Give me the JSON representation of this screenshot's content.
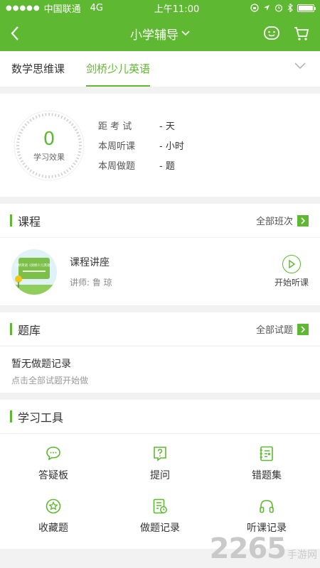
{
  "status": {
    "signal": "●●●●●",
    "carrier": "中国联通",
    "network": "4G",
    "time": "上午11:00",
    "battery_level": 1.0
  },
  "nav": {
    "title": "小学辅导"
  },
  "tabs": [
    {
      "label": "数学思维课",
      "active": false
    },
    {
      "label": "剑桥少儿英语",
      "active": true
    }
  ],
  "stats": {
    "score": "0",
    "score_label": "学习效果",
    "rows": [
      {
        "key": "距 考 试",
        "value": "- 天"
      },
      {
        "key": "本周听课",
        "value": "- 小时"
      },
      {
        "key": "本周做题",
        "value": "- 题"
      }
    ]
  },
  "course_section": {
    "title": "课程",
    "more": "全部班次",
    "item": {
      "name": "课程讲座",
      "teacher": "讲师:   鲁    琼",
      "action": "开始听课",
      "thumb_text": "剑桥英语《剑桥少儿英语》"
    }
  },
  "quiz_section": {
    "title": "题库",
    "more": "全部试题",
    "empty_title": "暂无做题记录",
    "empty_hint": "点击全部试题开始做"
  },
  "tools_section": {
    "title": "学习工具",
    "items": [
      {
        "label": "答疑板",
        "icon": "chat-icon"
      },
      {
        "label": "提问",
        "icon": "question-icon"
      },
      {
        "label": "错题集",
        "icon": "error-book-icon"
      },
      {
        "label": "收藏题",
        "icon": "star-icon"
      },
      {
        "label": "做题记录",
        "icon": "record-icon"
      },
      {
        "label": "听课记录",
        "icon": "headphones-icon"
      }
    ]
  },
  "watermark": {
    "number": "2265",
    "site": "手游网"
  },
  "colors": {
    "accent": "#5fb832"
  }
}
